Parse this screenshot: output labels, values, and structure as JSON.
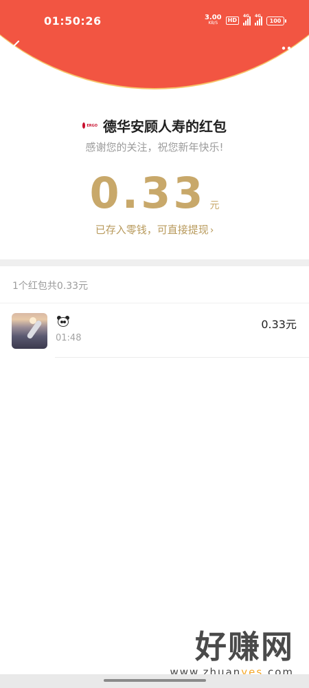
{
  "status_bar": {
    "time": "01:50:26",
    "net_speed_value": "3.00",
    "net_speed_unit": "KB/S",
    "hd_label": "HD",
    "signal_label_1": "4G",
    "signal_label_2": "4G",
    "battery": "100"
  },
  "nav": {
    "back_icon": "chevron-left-icon",
    "more_icon": "more-dots-icon"
  },
  "envelope": {
    "sender_logo": "ERGO",
    "sender_name": "德华安顾人寿的红包",
    "greeting": "感谢您的关注，祝您新年快乐!",
    "amount": "0.33",
    "amount_unit": "元",
    "deposit_text": "已存入零钱，可直接提现",
    "deposit_chevron": "›"
  },
  "summary": {
    "text": "1个红包共0.33元"
  },
  "records": [
    {
      "name_emoji": "panda-emoji",
      "time": "01:48",
      "amount": "0.33元"
    }
  ],
  "watermark": {
    "big_text": "好赚网",
    "domain_prefix": "www.zhuan",
    "domain_highlight": "yes",
    "domain_suffix": ".com"
  },
  "colors": {
    "header_red": "#f25542",
    "gold_text": "#c8a86a",
    "gold_border": "#f7c46a"
  }
}
